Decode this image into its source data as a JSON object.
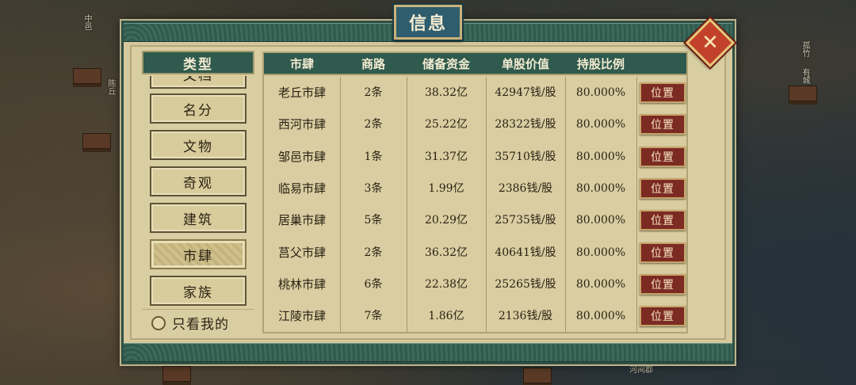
{
  "title": "信息",
  "close_icon": "close-icon",
  "sidebar": {
    "header": "类型",
    "items": [
      {
        "label": "文档"
      },
      {
        "label": "名分"
      },
      {
        "label": "文物"
      },
      {
        "label": "奇观"
      },
      {
        "label": "建筑"
      },
      {
        "label": "市肆",
        "active": true
      },
      {
        "label": "家族"
      }
    ],
    "mine_toggle_label": "只看我的"
  },
  "table": {
    "columns": [
      "市肆",
      "商路",
      "储备资金",
      "单股价值",
      "持股比例"
    ],
    "button_label": "位置",
    "rows": [
      {
        "name": "老丘市肆",
        "routes": "2条",
        "reserve": "38.32亿",
        "share_value": "42947钱/股",
        "ratio": "80.000%"
      },
      {
        "name": "西河市肆",
        "routes": "2条",
        "reserve": "25.22亿",
        "share_value": "28322钱/股",
        "ratio": "80.000%"
      },
      {
        "name": "邹邑市肆",
        "routes": "1条",
        "reserve": "31.37亿",
        "share_value": "35710钱/股",
        "ratio": "80.000%"
      },
      {
        "name": "临易市肆",
        "routes": "3条",
        "reserve": "1.99亿",
        "share_value": "2386钱/股",
        "ratio": "80.000%"
      },
      {
        "name": "居巢市肆",
        "routes": "5条",
        "reserve": "20.29亿",
        "share_value": "25735钱/股",
        "ratio": "80.000%"
      },
      {
        "name": "莒父市肆",
        "routes": "2条",
        "reserve": "36.32亿",
        "share_value": "40641钱/股",
        "ratio": "80.000%"
      },
      {
        "name": "桃林市肆",
        "routes": "6条",
        "reserve": "22.38亿",
        "share_value": "25265钱/股",
        "ratio": "80.000%"
      },
      {
        "name": "江陵市肆",
        "routes": "7条",
        "reserve": "1.86亿",
        "share_value": "2136钱/股",
        "ratio": "80.000%"
      }
    ]
  },
  "map_labels": [
    "中邑",
    "孤竹",
    "有城",
    "陈丘",
    "河间郡"
  ],
  "colors": {
    "panel_green": "#2f5a4d",
    "parchment": "#d9cda1",
    "button_red": "#7c2b22",
    "close_red": "#c2412b"
  }
}
